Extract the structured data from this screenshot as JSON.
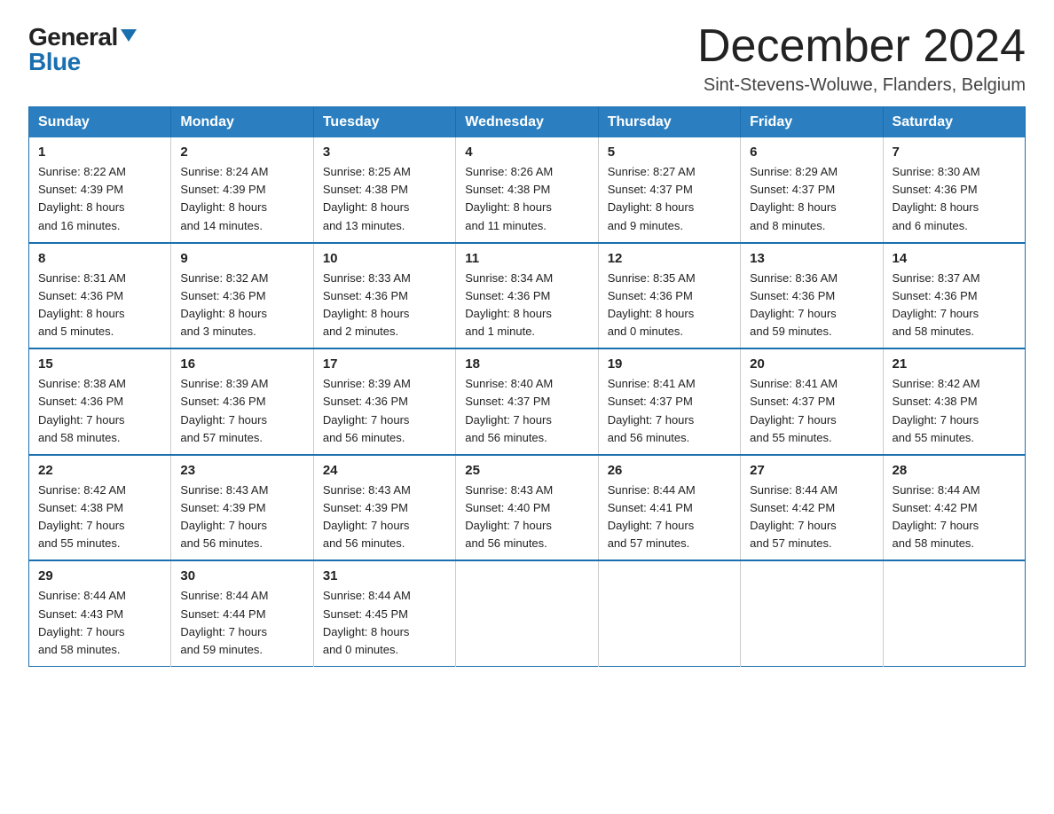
{
  "logo": {
    "general": "General",
    "blue": "Blue",
    "triangle": "▲"
  },
  "title": "December 2024",
  "subtitle": "Sint-Stevens-Woluwe, Flanders, Belgium",
  "days_of_week": [
    "Sunday",
    "Monday",
    "Tuesday",
    "Wednesday",
    "Thursday",
    "Friday",
    "Saturday"
  ],
  "weeks": [
    [
      {
        "day": "1",
        "info": "Sunrise: 8:22 AM\nSunset: 4:39 PM\nDaylight: 8 hours\nand 16 minutes."
      },
      {
        "day": "2",
        "info": "Sunrise: 8:24 AM\nSunset: 4:39 PM\nDaylight: 8 hours\nand 14 minutes."
      },
      {
        "day": "3",
        "info": "Sunrise: 8:25 AM\nSunset: 4:38 PM\nDaylight: 8 hours\nand 13 minutes."
      },
      {
        "day": "4",
        "info": "Sunrise: 8:26 AM\nSunset: 4:38 PM\nDaylight: 8 hours\nand 11 minutes."
      },
      {
        "day": "5",
        "info": "Sunrise: 8:27 AM\nSunset: 4:37 PM\nDaylight: 8 hours\nand 9 minutes."
      },
      {
        "day": "6",
        "info": "Sunrise: 8:29 AM\nSunset: 4:37 PM\nDaylight: 8 hours\nand 8 minutes."
      },
      {
        "day": "7",
        "info": "Sunrise: 8:30 AM\nSunset: 4:36 PM\nDaylight: 8 hours\nand 6 minutes."
      }
    ],
    [
      {
        "day": "8",
        "info": "Sunrise: 8:31 AM\nSunset: 4:36 PM\nDaylight: 8 hours\nand 5 minutes."
      },
      {
        "day": "9",
        "info": "Sunrise: 8:32 AM\nSunset: 4:36 PM\nDaylight: 8 hours\nand 3 minutes."
      },
      {
        "day": "10",
        "info": "Sunrise: 8:33 AM\nSunset: 4:36 PM\nDaylight: 8 hours\nand 2 minutes."
      },
      {
        "day": "11",
        "info": "Sunrise: 8:34 AM\nSunset: 4:36 PM\nDaylight: 8 hours\nand 1 minute."
      },
      {
        "day": "12",
        "info": "Sunrise: 8:35 AM\nSunset: 4:36 PM\nDaylight: 8 hours\nand 0 minutes."
      },
      {
        "day": "13",
        "info": "Sunrise: 8:36 AM\nSunset: 4:36 PM\nDaylight: 7 hours\nand 59 minutes."
      },
      {
        "day": "14",
        "info": "Sunrise: 8:37 AM\nSunset: 4:36 PM\nDaylight: 7 hours\nand 58 minutes."
      }
    ],
    [
      {
        "day": "15",
        "info": "Sunrise: 8:38 AM\nSunset: 4:36 PM\nDaylight: 7 hours\nand 58 minutes."
      },
      {
        "day": "16",
        "info": "Sunrise: 8:39 AM\nSunset: 4:36 PM\nDaylight: 7 hours\nand 57 minutes."
      },
      {
        "day": "17",
        "info": "Sunrise: 8:39 AM\nSunset: 4:36 PM\nDaylight: 7 hours\nand 56 minutes."
      },
      {
        "day": "18",
        "info": "Sunrise: 8:40 AM\nSunset: 4:37 PM\nDaylight: 7 hours\nand 56 minutes."
      },
      {
        "day": "19",
        "info": "Sunrise: 8:41 AM\nSunset: 4:37 PM\nDaylight: 7 hours\nand 56 minutes."
      },
      {
        "day": "20",
        "info": "Sunrise: 8:41 AM\nSunset: 4:37 PM\nDaylight: 7 hours\nand 55 minutes."
      },
      {
        "day": "21",
        "info": "Sunrise: 8:42 AM\nSunset: 4:38 PM\nDaylight: 7 hours\nand 55 minutes."
      }
    ],
    [
      {
        "day": "22",
        "info": "Sunrise: 8:42 AM\nSunset: 4:38 PM\nDaylight: 7 hours\nand 55 minutes."
      },
      {
        "day": "23",
        "info": "Sunrise: 8:43 AM\nSunset: 4:39 PM\nDaylight: 7 hours\nand 56 minutes."
      },
      {
        "day": "24",
        "info": "Sunrise: 8:43 AM\nSunset: 4:39 PM\nDaylight: 7 hours\nand 56 minutes."
      },
      {
        "day": "25",
        "info": "Sunrise: 8:43 AM\nSunset: 4:40 PM\nDaylight: 7 hours\nand 56 minutes."
      },
      {
        "day": "26",
        "info": "Sunrise: 8:44 AM\nSunset: 4:41 PM\nDaylight: 7 hours\nand 57 minutes."
      },
      {
        "day": "27",
        "info": "Sunrise: 8:44 AM\nSunset: 4:42 PM\nDaylight: 7 hours\nand 57 minutes."
      },
      {
        "day": "28",
        "info": "Sunrise: 8:44 AM\nSunset: 4:42 PM\nDaylight: 7 hours\nand 58 minutes."
      }
    ],
    [
      {
        "day": "29",
        "info": "Sunrise: 8:44 AM\nSunset: 4:43 PM\nDaylight: 7 hours\nand 58 minutes."
      },
      {
        "day": "30",
        "info": "Sunrise: 8:44 AM\nSunset: 4:44 PM\nDaylight: 7 hours\nand 59 minutes."
      },
      {
        "day": "31",
        "info": "Sunrise: 8:44 AM\nSunset: 4:45 PM\nDaylight: 8 hours\nand 0 minutes."
      },
      {
        "day": "",
        "info": ""
      },
      {
        "day": "",
        "info": ""
      },
      {
        "day": "",
        "info": ""
      },
      {
        "day": "",
        "info": ""
      }
    ]
  ]
}
